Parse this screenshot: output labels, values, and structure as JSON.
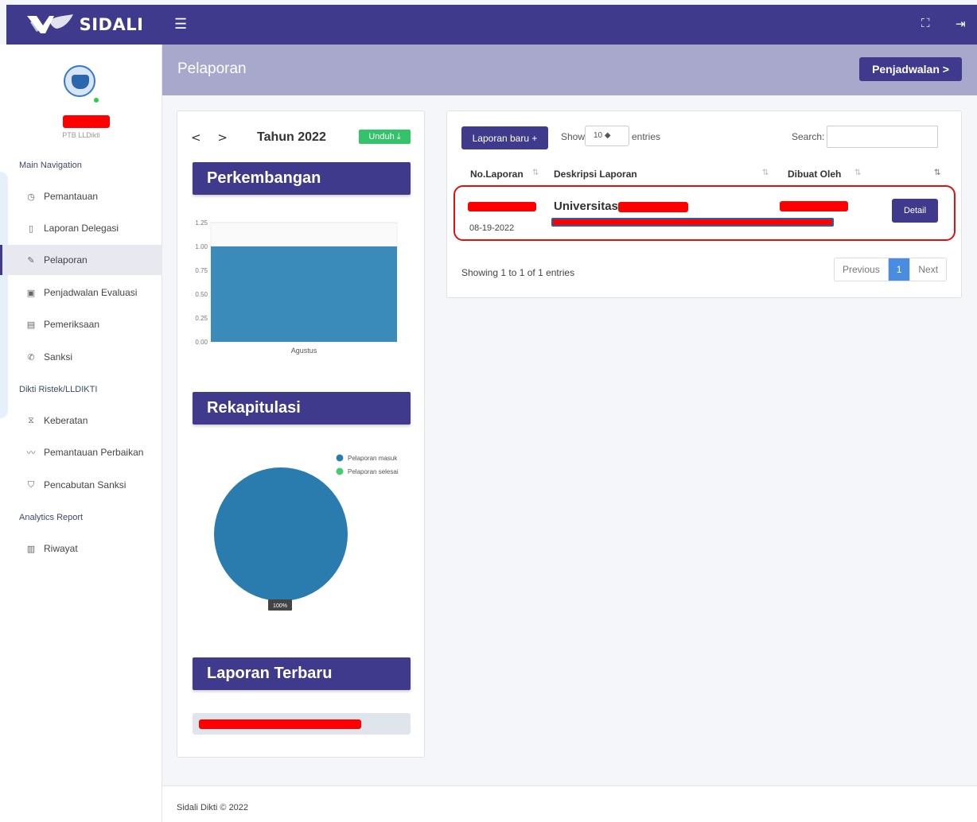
{
  "brand": {
    "name": "SIDALI"
  },
  "topbar": {
    "menu_icon": "☰",
    "fullscreen_icon": "⛶",
    "logout_icon": "⇥"
  },
  "sidebar": {
    "role": "PTB LLDikti",
    "sections": [
      {
        "header": "Main Navigation"
      },
      {
        "header": "Dikti Ristek/LLDIKTI"
      },
      {
        "header": "Analytics Report"
      }
    ],
    "items": [
      {
        "label": "Pemantauan",
        "icon": "◷"
      },
      {
        "label": "Laporan Delegasi",
        "icon": "▯"
      },
      {
        "label": "Pelaporan",
        "icon": "✎"
      },
      {
        "label": "Penjadwalan Evaluasi",
        "icon": "▣"
      },
      {
        "label": "Pemeriksaan",
        "icon": "▤"
      },
      {
        "label": "Sanksi",
        "icon": "✆"
      },
      {
        "label": "Keberatan",
        "icon": "⧖"
      },
      {
        "label": "Pemantauan Perbaikan",
        "icon": "〰"
      },
      {
        "label": "Pencabutan Sanksi",
        "icon": "⛉"
      },
      {
        "label": "Riwayat",
        "icon": "▥"
      }
    ]
  },
  "header": {
    "title": "Pelaporan",
    "next_button": "Penjadwalan >"
  },
  "left_panel": {
    "nav_arrows": "< >",
    "year_title": "Tahun 2022",
    "download_button": "Unduh ⤓",
    "sections": {
      "development": "Perkembangan",
      "recap": "Rekapitulasi",
      "latest": "Laporan Terbaru"
    }
  },
  "colors": {
    "primary": "#3f3a8c",
    "bar": "#3b8bba",
    "pie_masuk": "#2a7caf",
    "pie_selesai": "#3ecf6e",
    "pager_active": "#4a8de0"
  },
  "chart_data": [
    {
      "type": "bar",
      "categories": [
        "Agustus"
      ],
      "values": [
        1
      ],
      "ylim": [
        0,
        1.25
      ],
      "yticks": [
        "0.00",
        "0.25",
        "0.50",
        "0.75",
        "1.00",
        "1.25"
      ]
    },
    {
      "type": "pie",
      "labels": [
        "Pelaporan masuk",
        "Pelaporan selesai"
      ],
      "values": [
        100,
        0
      ],
      "data_label": "100%",
      "legend": "top-right"
    }
  ],
  "table": {
    "new_button": "Laporan baru +",
    "show_label": "Show",
    "entries_label": "entries",
    "page_length": "10 ◆",
    "search_label": "Search:",
    "columns": [
      "No.Laporan",
      "Deskripsi Laporan",
      "Dibuat Oleh"
    ],
    "row": {
      "date": "08-19-2022",
      "title": "Universitas",
      "action": "Detail"
    },
    "info": "Showing 1 to 1 of 1 entries",
    "pagination": {
      "previous": "Previous",
      "current": "1",
      "next": "Next"
    }
  },
  "footer": {
    "text": "Sidali Dikti © 2022"
  }
}
